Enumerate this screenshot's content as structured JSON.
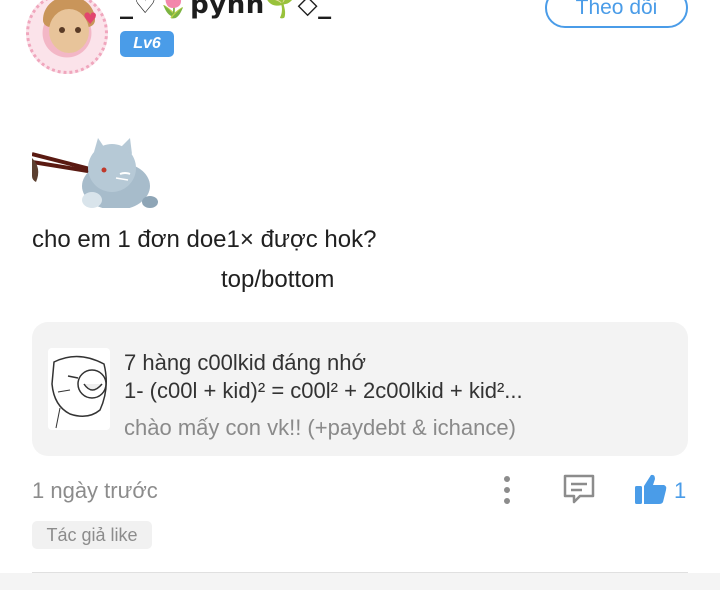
{
  "header": {
    "username": "_♡🌷pynh🌱◇_",
    "level_badge": "Lv6",
    "follow_label": "Theo dõi",
    "avatar_icon": "avatar-image"
  },
  "post": {
    "sticker_icon": "cat-with-chopsticks-sticker",
    "text_line1": "cho em 1 đơn doe1× được hok?",
    "text_line2": "top/bottom"
  },
  "link_card": {
    "title": "7 hàng c00lkid đáng nhớ",
    "body": "1- (c00l + kid)² = c00l² + 2c00lkid + kid²...",
    "subtitle": "chào mấy con vk!! (+paydebt & ichance)",
    "thumb_icon": "meme-face-thumbnail"
  },
  "footer": {
    "timestamp": "1 ngày trước",
    "like_count": "1",
    "author_like_label": "Tác giả like",
    "accent_color": "#4a9ce8"
  }
}
